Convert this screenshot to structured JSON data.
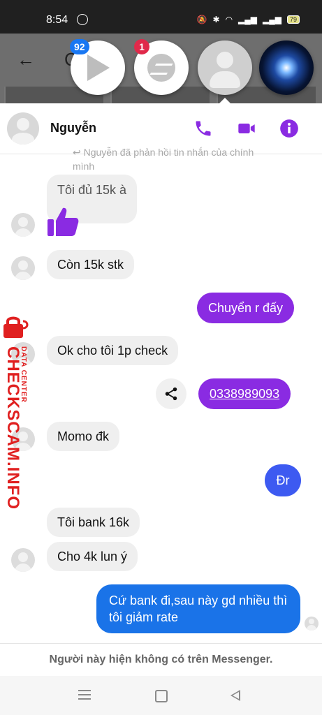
{
  "status_bar": {
    "time": "8:54",
    "battery": "79"
  },
  "background_app": {
    "title_fragment": "C"
  },
  "chat_heads": [
    {
      "name": "video-player",
      "badge": "92"
    },
    {
      "name": "messenger",
      "badge": "1"
    },
    {
      "name": "contact-avatar",
      "badge": ""
    },
    {
      "name": "galaxy-avatar",
      "badge": ""
    }
  ],
  "header": {
    "contact_name": "Nguyễn",
    "accent_color": "#8a2be2"
  },
  "reply_note": "Nguyễn đã phản hồi tin nhắn của chính mình",
  "messages": [
    {
      "dir": "in",
      "text": "Tôi đủ 15k à"
    },
    {
      "dir": "in",
      "text": "👍",
      "type": "like"
    },
    {
      "dir": "in",
      "text": "Còn 15k stk"
    },
    {
      "dir": "out",
      "text": "Chuyển r đấy",
      "color": "#8a2be2"
    },
    {
      "dir": "in",
      "text": "Ok cho tôi 1p check"
    },
    {
      "dir": "out",
      "text": "0338989093",
      "color": "#8a2be2",
      "type": "link"
    },
    {
      "dir": "in",
      "text": "Momo đk"
    },
    {
      "dir": "out",
      "text": "Đr",
      "color": "#3d5af1"
    },
    {
      "dir": "in",
      "text": "Tôi bank 16k"
    },
    {
      "dir": "in",
      "text": "Cho 4k lun ý"
    },
    {
      "dir": "out",
      "text": "Cứ bank đi,sau này gd nhiều thì tôi giảm rate",
      "color": "#1a73e8"
    }
  ],
  "footer_note": "Người này hiện không có trên Messenger.",
  "watermark": {
    "main": "CHECKSCAM.INFO",
    "sub": "DATA CENTER",
    "color": "#e02020"
  },
  "icons": [
    "phone-icon",
    "video-call-icon",
    "info-icon",
    "share-icon",
    "like-icon",
    "lock-icon"
  ]
}
